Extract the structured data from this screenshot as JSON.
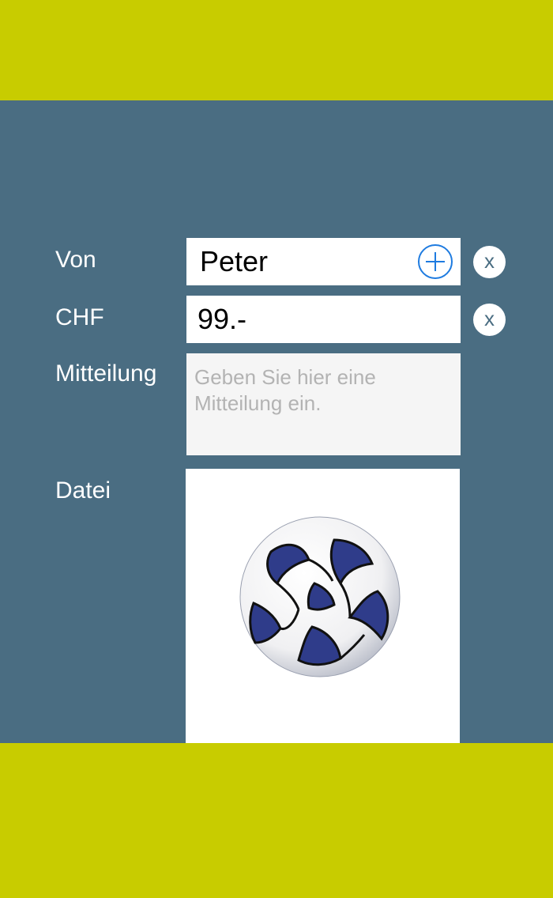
{
  "form": {
    "from_label": "Von",
    "from_value": "Peter",
    "amount_label": "CHF",
    "amount_value": "99.-",
    "message_label": "Mitteilung",
    "message_placeholder": "Geben Sie hier eine Mitteilung ein.",
    "file_label": "Datei",
    "clear_glyph": "x"
  },
  "icons": {
    "add": "plus-circle-icon",
    "clear": "clear-icon",
    "file": "soccer-ball-image"
  },
  "colors": {
    "accent": "#c8cc00",
    "background": "#4a6d82",
    "link": "#1e7be0"
  }
}
